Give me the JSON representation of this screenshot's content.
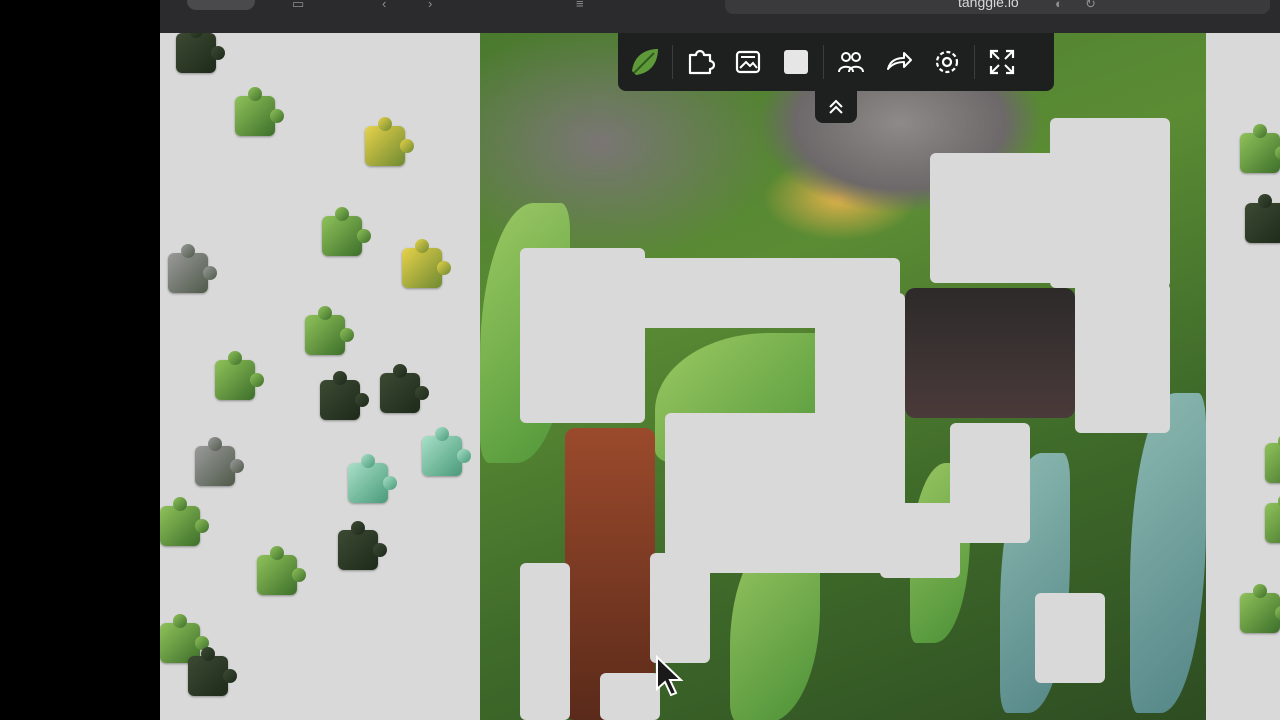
{
  "browser": {
    "url": "tanggle.io"
  },
  "toolbar": {
    "buttons": [
      {
        "name": "app-logo-button",
        "icon": "eucalyptus-leaf-icon"
      },
      {
        "name": "piece-shape-button",
        "icon": "puzzle-piece-icon"
      },
      {
        "name": "preview-image-button",
        "icon": "image-frame-icon"
      },
      {
        "name": "background-color-button",
        "icon": "color-swatch-icon"
      },
      {
        "name": "players-button",
        "icon": "users-icon"
      },
      {
        "name": "share-button",
        "icon": "share-arrow-icon"
      },
      {
        "name": "settings-button",
        "icon": "gear-icon"
      },
      {
        "name": "fullscreen-button",
        "icon": "expand-icon"
      }
    ],
    "collapse_icon": "chevron-up-double-icon"
  },
  "colors": {
    "toolbar_bg": "#1e1f1f",
    "tray_bg": "#d9d9d9",
    "icon": "#ffffff",
    "accent_leaf": "#5f9a3a"
  }
}
